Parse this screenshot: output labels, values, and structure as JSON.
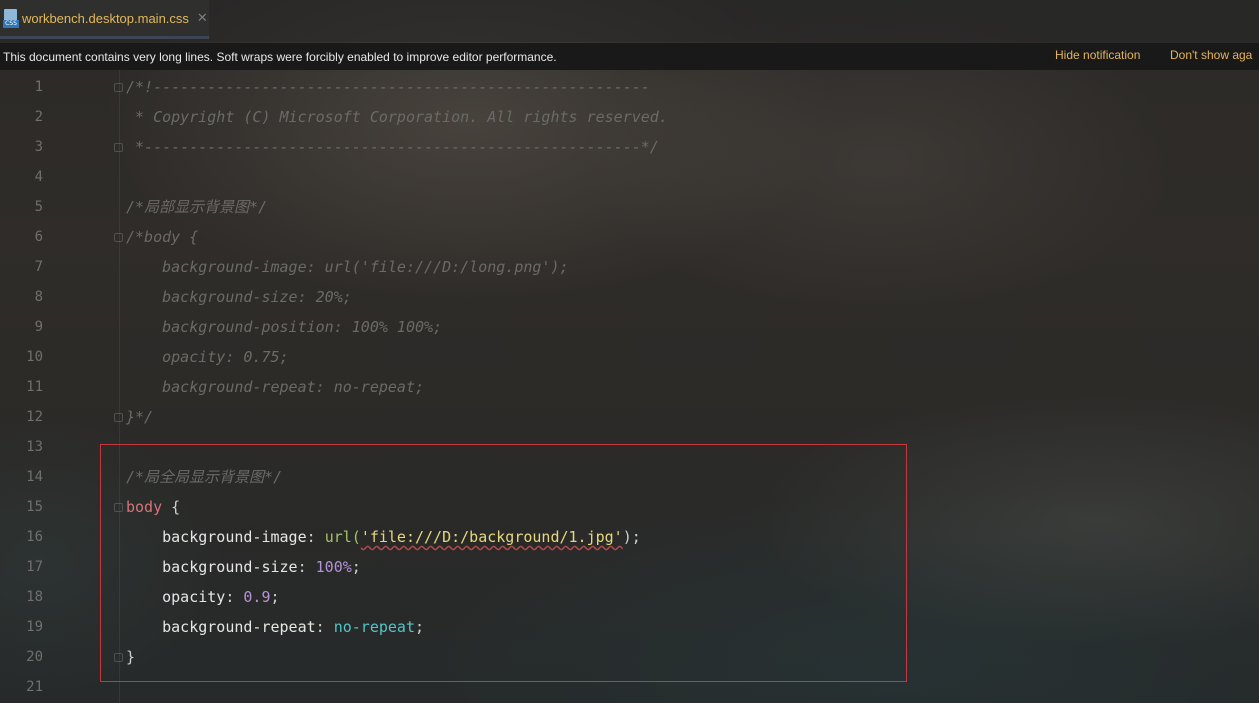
{
  "tab": {
    "title": "workbench.desktop.main.css",
    "close": "✕",
    "icon_label": "CSS"
  },
  "notification": {
    "message": "This document contains very long lines. Soft wraps were forcibly enabled to improve editor performance.",
    "hide_label": "Hide notification",
    "dont_show_label": "Don't show aga"
  },
  "lines": [
    {
      "n": "1",
      "text": "/*!-------------------------------------------------------"
    },
    {
      "n": "2",
      "text": " * Copyright (C) Microsoft Corporation. All rights reserved."
    },
    {
      "n": "3",
      "text": " *-------------------------------------------------------*/"
    },
    {
      "n": "4",
      "text": ""
    },
    {
      "n": "5",
      "text": "/*局部显示背景图*/"
    },
    {
      "n": "6",
      "text": "/*body {"
    },
    {
      "n": "7",
      "text": "    background-image: url('file:///D:/long.png');"
    },
    {
      "n": "8",
      "text": "    background-size: 20%;"
    },
    {
      "n": "9",
      "text": "    background-position: 100% 100%;"
    },
    {
      "n": "10",
      "text": "    opacity: 0.75;"
    },
    {
      "n": "11",
      "text": "    background-repeat: no-repeat;"
    },
    {
      "n": "12",
      "text": "}*/"
    },
    {
      "n": "13",
      "text": ""
    },
    {
      "n": "14",
      "text": "/*局全局显示背景图*/"
    },
    {
      "n": "15",
      "selector": "body",
      "brace": " {"
    },
    {
      "n": "16",
      "prop": "    background-image",
      "colon": ": ",
      "func": "url(",
      "str": "'file:///D:/background/1.jpg'",
      "close": ");"
    },
    {
      "n": "17",
      "prop": "    background-size",
      "colon": ": ",
      "num": "100%",
      "end": ";"
    },
    {
      "n": "18",
      "prop": "    opacity",
      "colon": ": ",
      "num": "0.9",
      "end": ";"
    },
    {
      "n": "19",
      "prop": "    background-repeat",
      "colon": ": ",
      "kw": "no-repeat",
      "end": ";"
    },
    {
      "n": "20",
      "text": "}"
    },
    {
      "n": "21",
      "text": ""
    }
  ],
  "colors": {
    "tab_title": "#e2b95a",
    "link": "#e4b55a",
    "selector": "#d7737a",
    "highlight_box": "#c8373c"
  }
}
